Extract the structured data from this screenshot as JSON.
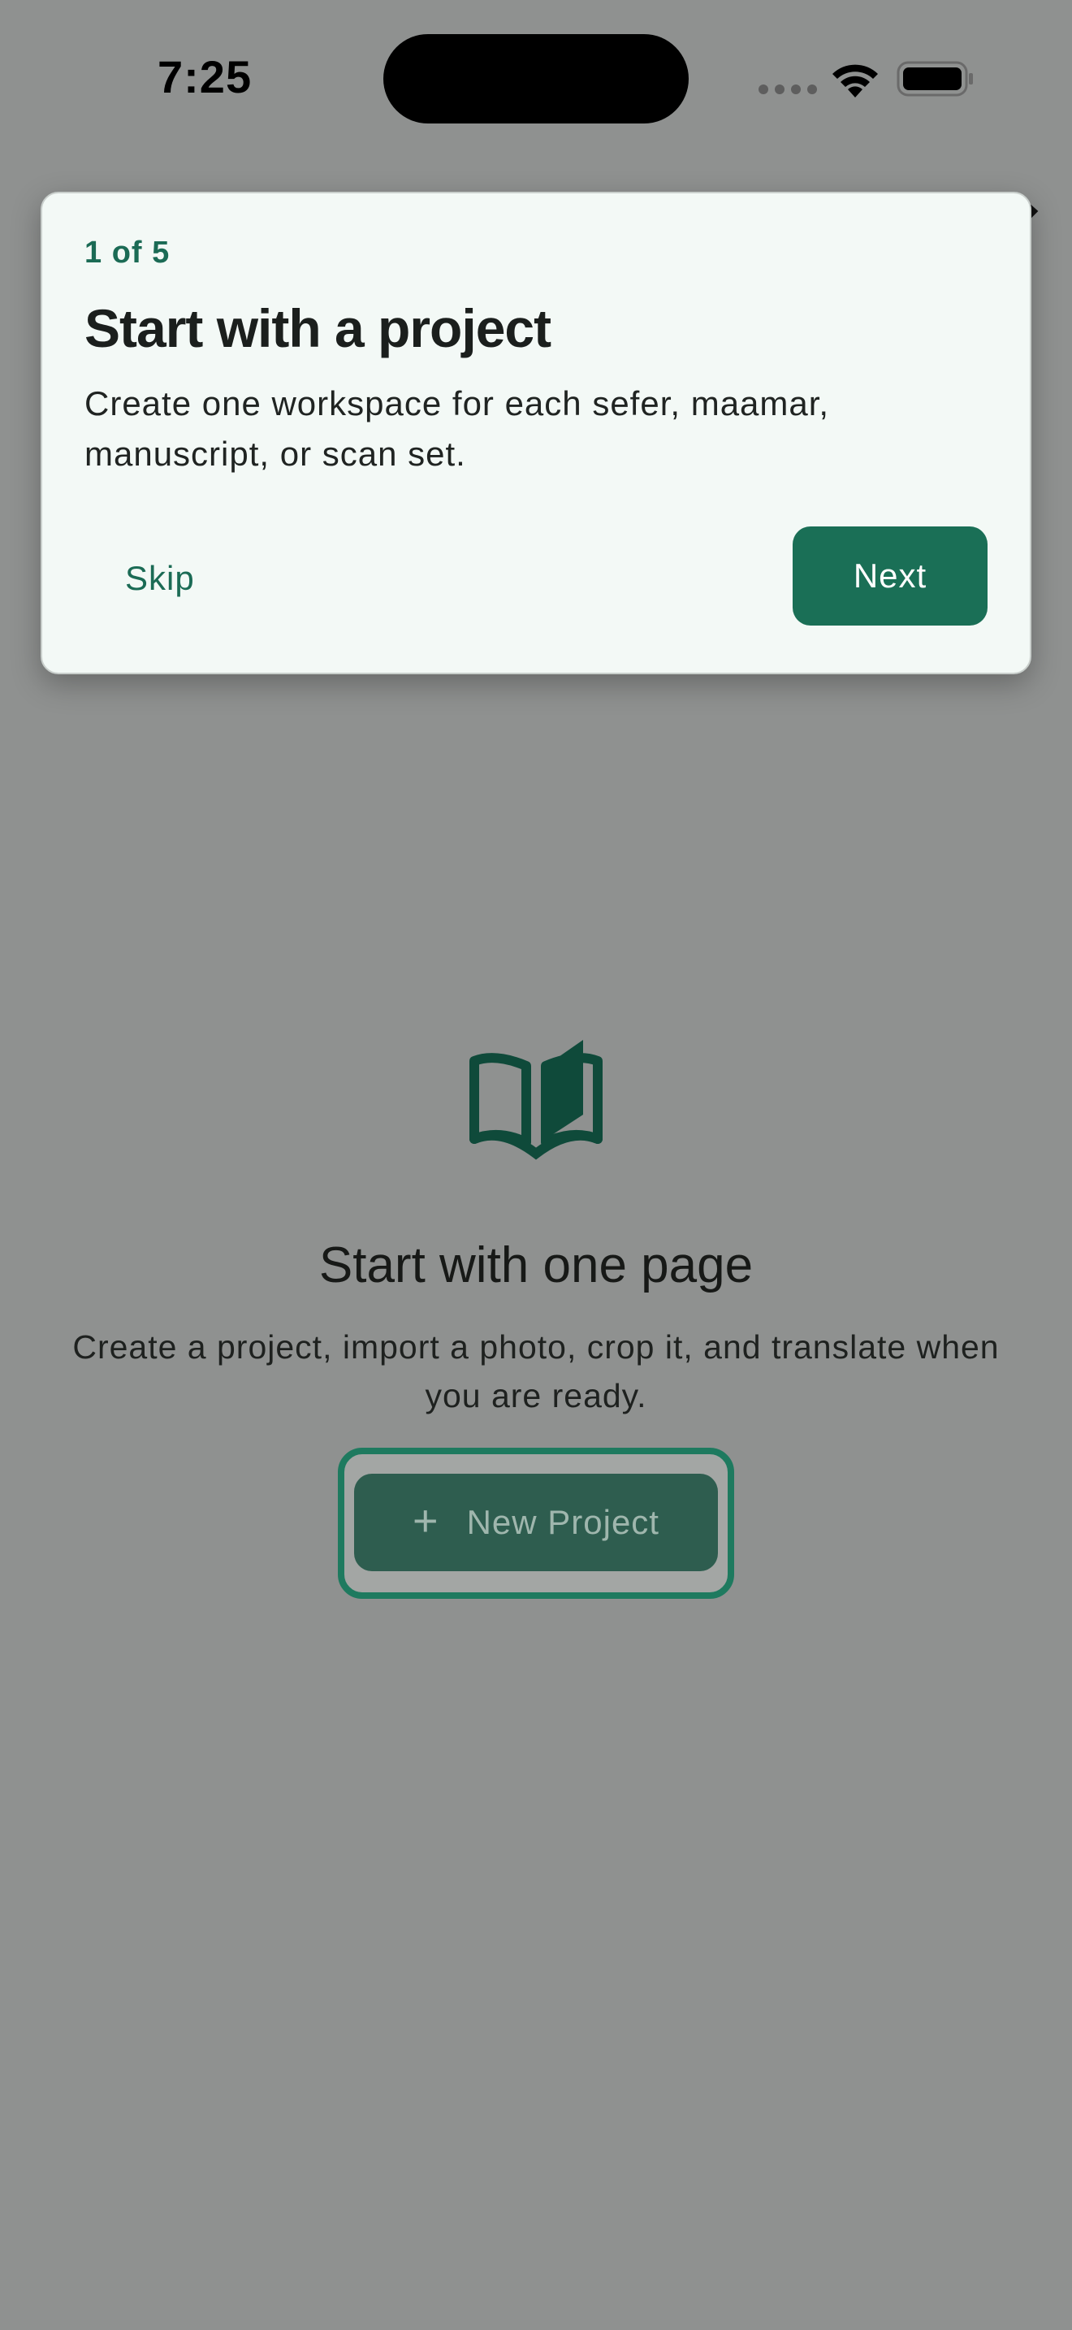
{
  "status_bar": {
    "time": "7:25"
  },
  "coach": {
    "step": "1 of 5",
    "title": "Start with a project",
    "body": "Create one workspace for each sefer, maamar, manuscript, or scan set.",
    "skip_label": "Skip",
    "next_label": "Next"
  },
  "empty_state": {
    "icon": "open-book-icon",
    "title": "Start with one page",
    "subtitle": "Create a project, import a photo, crop it, and translate when you are ready.",
    "button_icon": "+",
    "button_label": "New Project"
  },
  "colors": {
    "accent": "#1a6f56",
    "dim_overlay": "#8f9190",
    "card_background": "#f3f9f6"
  }
}
